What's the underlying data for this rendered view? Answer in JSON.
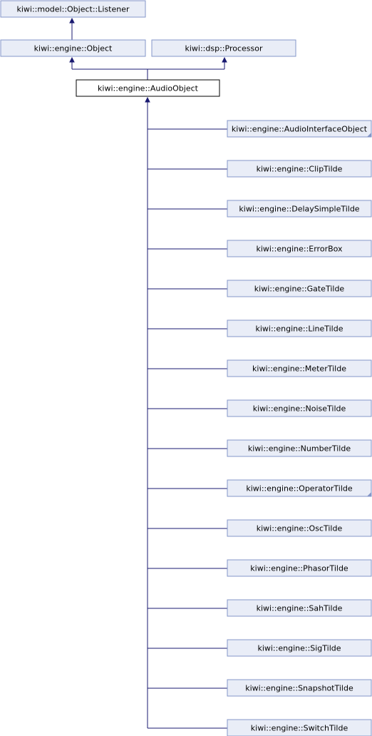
{
  "nodes": {
    "listener": {
      "label": "kiwi::model::Object::Listener",
      "is_current": false
    },
    "object": {
      "label": "kiwi::engine::Object",
      "is_current": false
    },
    "processor": {
      "label": "kiwi::dsp::Processor",
      "is_current": false
    },
    "audio_object": {
      "label": "kiwi::engine::AudioObject",
      "is_current": true
    }
  },
  "derived": [
    {
      "label": "kiwi::engine::AudioInterfaceObject",
      "has_more": true
    },
    {
      "label": "kiwi::engine::ClipTilde",
      "has_more": false
    },
    {
      "label": "kiwi::engine::DelaySimpleTilde",
      "has_more": false
    },
    {
      "label": "kiwi::engine::ErrorBox",
      "has_more": false
    },
    {
      "label": "kiwi::engine::GateTilde",
      "has_more": false
    },
    {
      "label": "kiwi::engine::LineTilde",
      "has_more": false
    },
    {
      "label": "kiwi::engine::MeterTilde",
      "has_more": false
    },
    {
      "label": "kiwi::engine::NoiseTilde",
      "has_more": false
    },
    {
      "label": "kiwi::engine::NumberTilde",
      "has_more": false
    },
    {
      "label": "kiwi::engine::OperatorTilde",
      "has_more": true
    },
    {
      "label": "kiwi::engine::OscTilde",
      "has_more": false
    },
    {
      "label": "kiwi::engine::PhasorTilde",
      "has_more": false
    },
    {
      "label": "kiwi::engine::SahTilde",
      "has_more": false
    },
    {
      "label": "kiwi::engine::SigTilde",
      "has_more": false
    },
    {
      "label": "kiwi::engine::SnapshotTilde",
      "has_more": false
    },
    {
      "label": "kiwi::engine::SwitchTilde",
      "has_more": false
    }
  ],
  "colors": {
    "node_fill": "#e9edf7",
    "node_border": "#8496c8",
    "edge": "#191970",
    "current_fill": "#ffffff",
    "current_border": "#000000"
  }
}
